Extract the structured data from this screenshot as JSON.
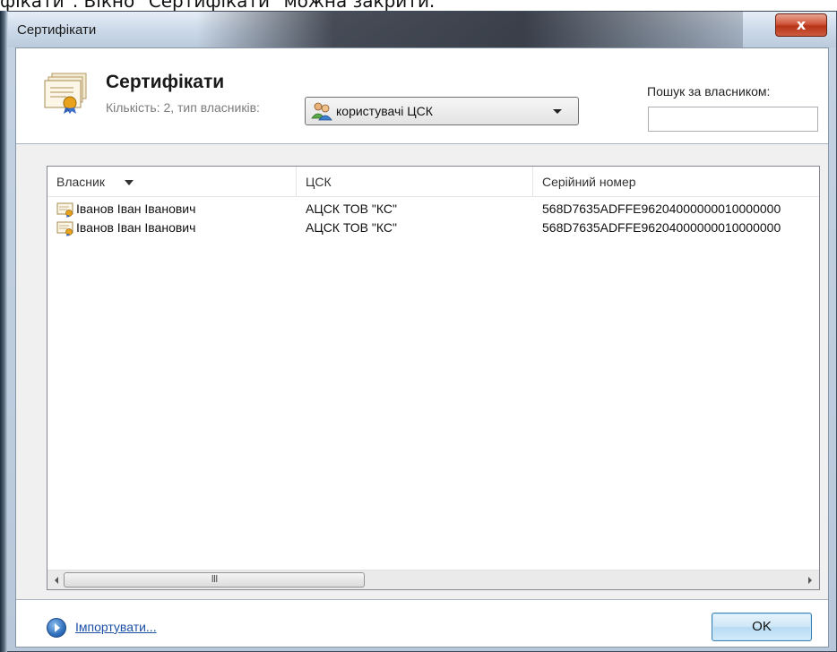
{
  "page_caption": "фікати\". Вікно \"Сертифікати\" можна закрити.",
  "window": {
    "title": "Сертифікати",
    "close_label": "x"
  },
  "header": {
    "title": "Сертифікати",
    "subtitle": "Кількість: 2, тип власників:",
    "owner_type_selected": "користувачі ЦСК",
    "search_label": "Пошук за власником:",
    "search_value": ""
  },
  "list": {
    "columns": [
      "Власник",
      "ЦСК",
      "Серійний номер"
    ],
    "rows": [
      {
        "owner": "Іванов Іван Іванович",
        "ca": "АЦСК ТОВ \"КС\"",
        "serial": "568D7635ADFFE96204000000010000000"
      },
      {
        "owner": "Іванов Іван Іванович",
        "ca": "АЦСК ТОВ \"КС\"",
        "serial": "568D7635ADFFE96204000000010000000"
      }
    ],
    "scroll_thumb_grip": "III"
  },
  "footer": {
    "import_label": "Імпортувати...",
    "ok_label": "OK"
  },
  "icons": {
    "header": "certificate-icon",
    "select": "users-icon",
    "row": "certificate-icon",
    "import": "arrow-circle-icon"
  },
  "colors": {
    "link": "#1a4fa3",
    "ok_button": "#cfe7f7",
    "close_button": "#c9462a"
  }
}
